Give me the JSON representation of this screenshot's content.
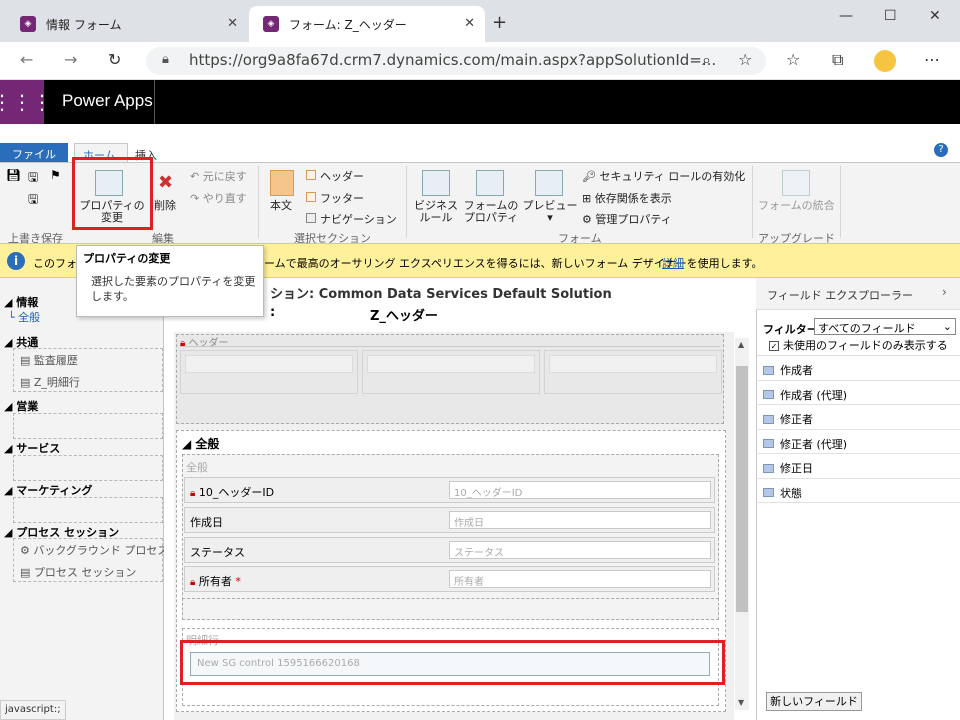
{
  "browser": {
    "tabs": [
      {
        "title": "情報 フォーム"
      },
      {
        "title": "フォーム: Z_ヘッダー"
      }
    ],
    "url": "https://org9a8fa67d.crm7.dynamics.com/main.aspx?appSolutionId=..."
  },
  "app": {
    "title": "Power Apps"
  },
  "ribbon": {
    "tabs": {
      "file": "ファイル",
      "home": "ホーム",
      "insert": "挿入"
    },
    "groups": {
      "save": "上書き保存",
      "edit": "編集",
      "select": "選択セクション",
      "form": "フォーム",
      "upgrade": "アップグレード"
    },
    "buttons": {
      "properties": "プロパティの\n変更",
      "delete": "削除",
      "undo": "元に戻す",
      "redo": "やり直す",
      "body": "本文",
      "header": "ヘッダー",
      "footer": "フッター",
      "navigation": "ナビゲーション",
      "business_rule": "ビジネス\nルール",
      "form_properties": "フォームの\nプロパティ",
      "preview": "プレビュー",
      "security_roles": "セキュリティ ロールの有効化",
      "dependencies": "依存関係を表示",
      "managed_props": "管理プロパティ",
      "merge_forms": "フォームの統合"
    }
  },
  "tooltip": {
    "title": "プロパティの変更",
    "body": "選択した要素のプロパティを変更します。"
  },
  "infobar": {
    "text_left": "このフォーム",
    "text_right": "ームで最高のオーサリング エクスペリエンスを得るには、新しいフォーム デザイナーを使用します。",
    "link": "詳細"
  },
  "leftnav": {
    "info_head": "情報",
    "all": "全般",
    "common_head": "共通",
    "common_items": [
      "監査履歴",
      "Z_明細行"
    ],
    "sales_head": "営業",
    "service_head": "サービス",
    "marketing_head": "マーケティング",
    "process_head": "プロセス セッション",
    "process_items": [
      "バックグラウンド プロセス",
      "プロセス セッション"
    ]
  },
  "editor": {
    "solution": "ション: Common Data Services Default Solution",
    "form_label": ":",
    "form_name": "Z_ヘッダー",
    "header_label": "ヘッダー",
    "tab_label": "全般",
    "section_label": "全般",
    "fields": [
      {
        "label": "10_ヘッダーID",
        "placeholder": "10_ヘッダーID",
        "locked": true,
        "required": false
      },
      {
        "label": "作成日",
        "placeholder": "作成日",
        "locked": false,
        "required": false
      },
      {
        "label": "ステータス",
        "placeholder": "ステータス",
        "locked": false,
        "required": false
      },
      {
        "label": "所有者",
        "placeholder": "所有者",
        "locked": true,
        "required": true
      }
    ],
    "subgrid_section": "明細行",
    "subgrid_name": "New SG control 1595166620168"
  },
  "field_explorer": {
    "title": "フィールド エクスプローラー",
    "filter_label": "フィルター",
    "filter_value": "すべてのフィールド",
    "unused_only": "未使用のフィールドのみ表示する",
    "fields": [
      "作成者",
      "作成者 (代理)",
      "修正者",
      "修正者 (代理)",
      "修正日",
      "状態"
    ],
    "new_field": "新しいフィールド"
  },
  "status_text": "javascript:;"
}
